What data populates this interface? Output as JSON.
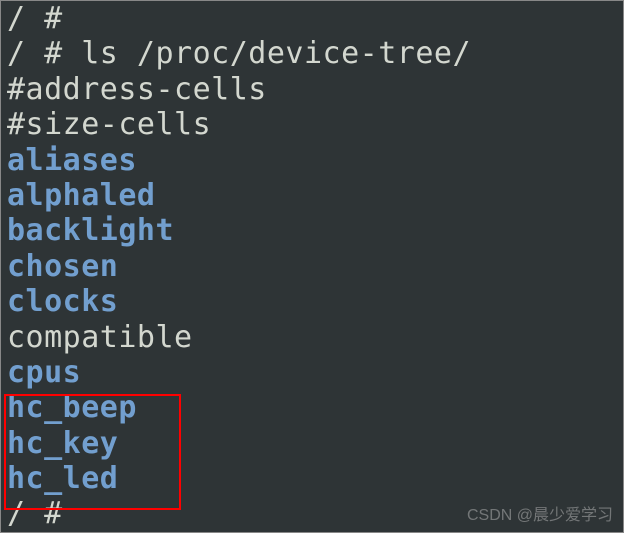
{
  "terminal": {
    "prompt_prev": "/ #",
    "command_line": "/ # ls /proc/device-tree/",
    "entries": [
      {
        "text": "#address-cells",
        "type": "plain"
      },
      {
        "text": "#size-cells",
        "type": "plain"
      },
      {
        "text": "aliases",
        "type": "dir"
      },
      {
        "text": "alphaled",
        "type": "dir"
      },
      {
        "text": "backlight",
        "type": "dir"
      },
      {
        "text": "chosen",
        "type": "dir"
      },
      {
        "text": "clocks",
        "type": "dir"
      },
      {
        "text": "compatible",
        "type": "plain"
      },
      {
        "text": "cpus",
        "type": "dir"
      },
      {
        "text": "hc_beep",
        "type": "dir"
      },
      {
        "text": "hc_key",
        "type": "dir"
      },
      {
        "text": "hc_led",
        "type": "dir"
      }
    ],
    "prompt_after": "/ #"
  },
  "watermark": "CSDN @晨少爱学习"
}
